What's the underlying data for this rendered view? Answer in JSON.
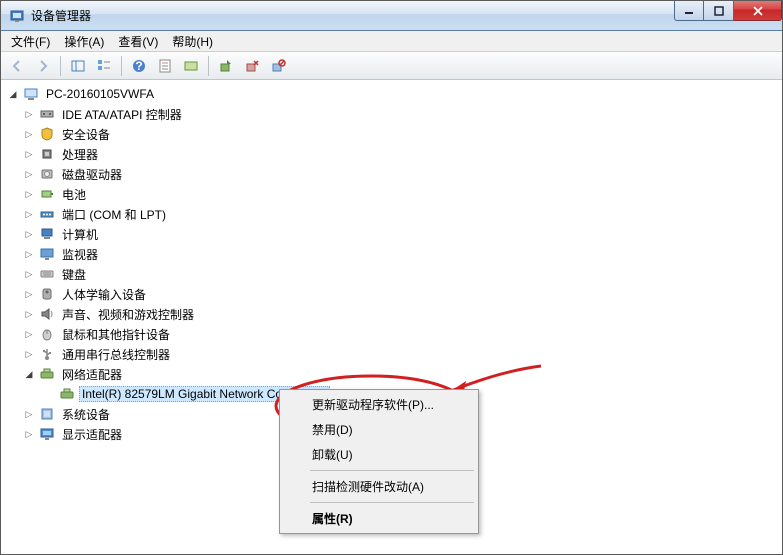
{
  "window": {
    "title": "设备管理器"
  },
  "menubar": {
    "items": [
      {
        "label": "文件(F)"
      },
      {
        "label": "操作(A)"
      },
      {
        "label": "查看(V)"
      },
      {
        "label": "帮助(H)"
      }
    ]
  },
  "tree": {
    "root": "PC-20160105VWFA",
    "nodes": [
      {
        "label": "IDE ATA/ATAPI 控制器",
        "icon": "ide"
      },
      {
        "label": "安全设备",
        "icon": "security"
      },
      {
        "label": "处理器",
        "icon": "cpu"
      },
      {
        "label": "磁盘驱动器",
        "icon": "disk"
      },
      {
        "label": "电池",
        "icon": "battery"
      },
      {
        "label": "端口 (COM 和 LPT)",
        "icon": "port"
      },
      {
        "label": "计算机",
        "icon": "computer"
      },
      {
        "label": "监视器",
        "icon": "monitor"
      },
      {
        "label": "键盘",
        "icon": "keyboard"
      },
      {
        "label": "人体学输入设备",
        "icon": "hid"
      },
      {
        "label": "声音、视频和游戏控制器",
        "icon": "sound"
      },
      {
        "label": "鼠标和其他指针设备",
        "icon": "mouse"
      },
      {
        "label": "通用串行总线控制器",
        "icon": "usb"
      },
      {
        "label": "网络适配器",
        "icon": "network",
        "expanded": true,
        "children": [
          {
            "label": "Intel(R) 82579LM Gigabit Network Connection",
            "icon": "nic",
            "selected": true
          }
        ]
      },
      {
        "label": "系统设备",
        "icon": "system"
      },
      {
        "label": "显示适配器",
        "icon": "display"
      }
    ]
  },
  "contextMenu": {
    "items": [
      {
        "label": "更新驱动程序软件(P)...",
        "type": "item"
      },
      {
        "label": "禁用(D)",
        "type": "item"
      },
      {
        "label": "卸载(U)",
        "type": "item"
      },
      {
        "type": "sep"
      },
      {
        "label": "扫描检测硬件改动(A)",
        "type": "item"
      },
      {
        "type": "sep"
      },
      {
        "label": "属性(R)",
        "type": "item",
        "bold": true
      }
    ]
  }
}
